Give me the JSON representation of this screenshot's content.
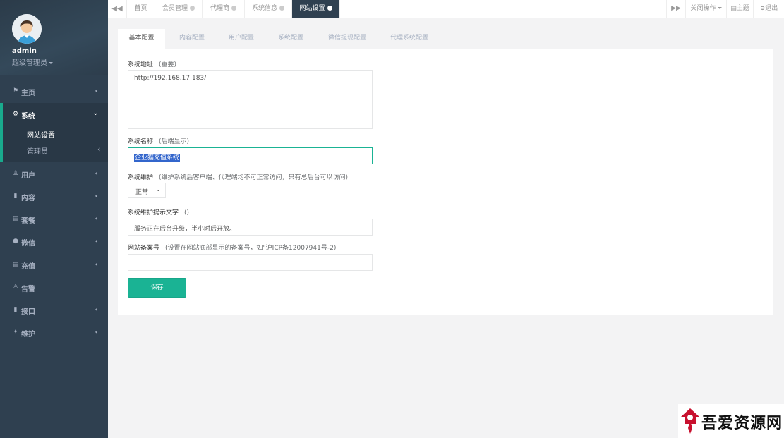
{
  "profile": {
    "name": "admin",
    "role": "超级管理员"
  },
  "sidebar": {
    "items": [
      {
        "icon": "home-icon",
        "label": "主页"
      },
      {
        "icon": "cogs-icon",
        "label": "系统"
      },
      {
        "icon": "users-icon",
        "label": "用户"
      },
      {
        "icon": "file-icon",
        "label": "内容"
      },
      {
        "icon": "file-text-icon",
        "label": "套餐"
      },
      {
        "icon": "wechat-icon",
        "label": "微信"
      },
      {
        "icon": "file-text-icon",
        "label": "充值"
      },
      {
        "icon": "users-icon",
        "label": "告警"
      },
      {
        "icon": "file-icon",
        "label": "接口"
      },
      {
        "icon": "magic-icon",
        "label": "维护"
      }
    ],
    "sub_items": [
      "网站设置",
      "管理员"
    ]
  },
  "topbar": {
    "tabs": [
      "首页",
      "会员管理",
      "代理商",
      "系统信息",
      "网站设置"
    ],
    "close_ops": "关闭操作",
    "theme": "主题",
    "logout": "退出"
  },
  "panel": {
    "tabs": [
      "基本配置",
      "内容配置",
      "用户配置",
      "系统配置",
      "微信提现配置",
      "代理系统配置"
    ],
    "fields": {
      "address_label": "系统地址",
      "address_hint": "(重要)",
      "address_value": "http://192.168.17.183/",
      "name_label": "系统名称",
      "name_hint": "(后端显示)",
      "name_value": "企业猫充值系统",
      "maint_label": "系统维护",
      "maint_hint": "(维护系统后客户端、代理端均不可正常访问，只有总后台可以访问)",
      "maint_value": "正常",
      "maint_text_label": "系统维护提示文字",
      "maint_text_hint": "()",
      "maint_text_value": "服务正在后台升级，半小时后开放。",
      "icp_label": "网站备案号",
      "icp_hint": "(设置在网站底部显示的备案号，如\"沪ICP备12007941号-2)",
      "icp_value": ""
    },
    "save": "保存"
  },
  "watermark": {
    "text": "吾爱资源网"
  },
  "colors": {
    "sidebar": "#2f4050",
    "accent": "#1ab394",
    "page_bg": "#f3f3f4"
  }
}
